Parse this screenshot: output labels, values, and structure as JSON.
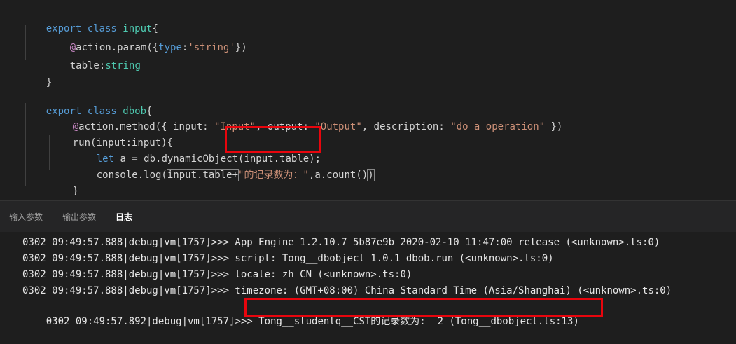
{
  "editor": {
    "lines": [
      {
        "pre": "export class ",
        "name": "input",
        "post": "{"
      },
      {
        "deco": "@",
        "fn": "action.param",
        "open": "({",
        "key": "type",
        "colon": ":",
        "val": "'string'",
        "close": "})"
      },
      {
        "field": "table",
        "colon": ":",
        "type": "string"
      },
      {
        "brace": "}"
      },
      {
        "pre": "export class ",
        "name": "dbob",
        "post": "{"
      },
      {
        "deco": "@",
        "fn": "action.method",
        "a": "({ input: ",
        "s1": "\"Input\"",
        "b": ", output: ",
        "s2": "\"Output\"",
        "c": ", description: ",
        "s3": "\"do a operation\"",
        "d": " })"
      },
      {
        "text": "run(input:input){"
      },
      {
        "kw": "let",
        "text": " a = db.dynamicObject(input.table);"
      },
      {
        "a": "console.log(",
        "b": "input.table+",
        "s": "\"的记录数为：\"",
        "c": ",a.count()",
        "d": ")"
      },
      {
        "brace": "}"
      },
      {
        "brace": "}"
      }
    ]
  },
  "panel": {
    "tabs": [
      "输入参数",
      "输出参数",
      "日志"
    ],
    "active_tab": "日志",
    "log": [
      "0302 09:49:57.888|debug|vm[1757]>>> App Engine 1.2.10.7 5b87e9b 2020-02-10 11:47:00 release (<unknown>.ts:0)",
      "0302 09:49:57.888|debug|vm[1757]>>> script: Tong__dbobject 1.0.1 dbob.run (<unknown>.ts:0)",
      "0302 09:49:57.888|debug|vm[1757]>>> locale: zh_CN (<unknown>.ts:0)",
      "0302 09:49:57.888|debug|vm[1757]>>> timezone: (GMT+08:00) China Standard Time (Asia/Shanghai) (<unknown>.ts:0)",
      {
        "prefix": "0302 09:49:57.892|debug|vm[1757]>>> ",
        "msg": "Tong__studentq__CST的记录数为:  2 (Tong__dbobject.ts:13)"
      }
    ]
  },
  "colors": {
    "highlight_box": "#e8050d",
    "keyword": "#569cd6",
    "type": "#4ec9b0",
    "string": "#ce9178",
    "decorator": "#c586c0"
  }
}
